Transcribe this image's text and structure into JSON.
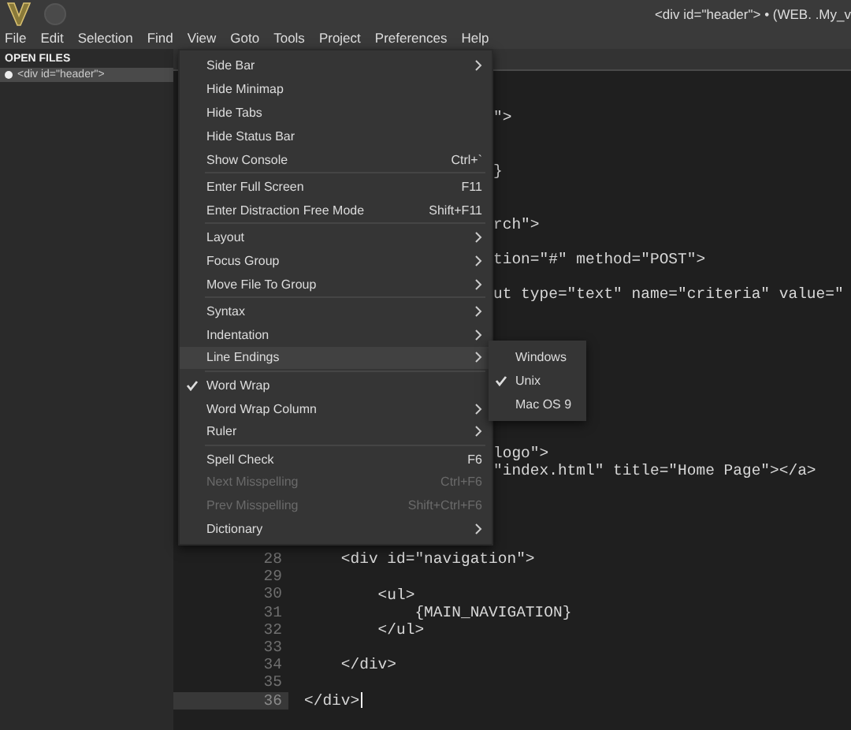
{
  "window": {
    "title": "<div id=\"header\"> • (WEB. .My_v"
  },
  "menu_bar": [
    "File",
    "Edit",
    "Selection",
    "Find",
    "View",
    "Goto",
    "Tools",
    "Project",
    "Preferences",
    "Help"
  ],
  "sidebar": {
    "heading": "OPEN FILES",
    "files": [
      {
        "label": "<div id=\"header\">",
        "selected": true
      }
    ]
  },
  "editor": {
    "lines": [
      {
        "kind": "blank",
        "current": false
      },
      {
        "kind": "blank",
        "current": false
      },
      {
        "kind": "fragment",
        "code": "\">",
        "current": false
      },
      {
        "kind": "blank",
        "current": false
      },
      {
        "kind": "blank",
        "current": false
      },
      {
        "kind": "fragment",
        "code": "}",
        "current": false
      },
      {
        "kind": "blank",
        "current": false
      },
      {
        "kind": "blank",
        "current": false
      },
      {
        "kind": "fragment",
        "code": "rch\">",
        "current": false
      },
      {
        "kind": "blank",
        "current": false
      },
      {
        "kind": "fragment",
        "code": "tion=\"#\" method=\"POST\">",
        "current": false
      },
      {
        "kind": "blank",
        "current": false
      },
      {
        "kind": "fragment",
        "code": "ut type=\"text\" name=\"criteria\" value=\"",
        "current": false
      },
      {
        "kind": "blank",
        "current": false
      },
      {
        "kind": "blank",
        "current": false
      },
      {
        "kind": "blank",
        "current": false
      },
      {
        "kind": "blank",
        "current": false
      },
      {
        "kind": "blank",
        "current": false
      },
      {
        "kind": "blank",
        "current": false
      },
      {
        "kind": "blank",
        "current": false
      },
      {
        "kind": "blank",
        "current": false
      },
      {
        "kind": "fragment",
        "code": "logo\">",
        "current": false
      },
      {
        "kind": "fragment",
        "code": "\"index.html\" title=\"Home Page\"></a>",
        "current": false
      },
      {
        "kind": "blank",
        "current": false
      },
      {
        "kind": "blank",
        "current": false
      },
      {
        "kind": "blank",
        "current": false
      },
      {
        "kind": "blank",
        "current": false
      },
      {
        "kind": "numbered",
        "number": "28",
        "code": "    <div id=\"navigation\">",
        "current": false
      },
      {
        "kind": "numbered",
        "number": "29",
        "current": false
      },
      {
        "kind": "numbered",
        "number": "30",
        "code": "        <ul>",
        "current": false
      },
      {
        "kind": "numbered",
        "number": "31",
        "code": "            {MAIN_NAVIGATION}",
        "current": false
      },
      {
        "kind": "numbered",
        "number": "32",
        "code": "        </ul>",
        "current": false
      },
      {
        "kind": "numbered",
        "number": "33",
        "current": false
      },
      {
        "kind": "numbered",
        "number": "34",
        "code": "    </div>",
        "current": false
      },
      {
        "kind": "numbered",
        "number": "35",
        "current": false
      },
      {
        "kind": "numbered",
        "number": "36",
        "code": "</div>",
        "current": true
      }
    ]
  },
  "view_menu": {
    "items": [
      {
        "kind": "item",
        "label": "Side Bar",
        "submenu": true,
        "checked": false,
        "disabled": false,
        "selected": false
      },
      {
        "kind": "item",
        "label": "Hide Minimap",
        "submenu": false,
        "checked": false,
        "disabled": false,
        "selected": false
      },
      {
        "kind": "item",
        "label": "Hide Tabs",
        "submenu": false,
        "checked": false,
        "disabled": false,
        "selected": false
      },
      {
        "kind": "item",
        "label": "Hide Status Bar",
        "submenu": false,
        "checked": false,
        "disabled": false,
        "selected": false
      },
      {
        "kind": "item",
        "label": "Show Console",
        "shortcut": "Ctrl+`",
        "submenu": false,
        "checked": false,
        "disabled": false,
        "selected": false
      },
      {
        "kind": "separator"
      },
      {
        "kind": "item",
        "label": "Enter Full Screen",
        "shortcut": "F11",
        "submenu": false,
        "checked": false,
        "disabled": false,
        "selected": false
      },
      {
        "kind": "item",
        "label": "Enter Distraction Free Mode",
        "shortcut": "Shift+F11",
        "submenu": false,
        "checked": false,
        "disabled": false,
        "selected": false
      },
      {
        "kind": "separator"
      },
      {
        "kind": "item",
        "label": "Layout",
        "submenu": true,
        "checked": false,
        "disabled": false,
        "selected": false
      },
      {
        "kind": "item",
        "label": "Focus Group",
        "submenu": true,
        "checked": false,
        "disabled": false,
        "selected": false
      },
      {
        "kind": "item",
        "label": "Move File To Group",
        "submenu": true,
        "checked": false,
        "disabled": false,
        "selected": false
      },
      {
        "kind": "separator"
      },
      {
        "kind": "item",
        "label": "Syntax",
        "submenu": true,
        "checked": false,
        "disabled": false,
        "selected": false
      },
      {
        "kind": "item",
        "label": "Indentation",
        "submenu": true,
        "checked": false,
        "disabled": false,
        "selected": false
      },
      {
        "kind": "item",
        "label": "Line Endings",
        "submenu": true,
        "checked": false,
        "disabled": false,
        "selected": true
      },
      {
        "kind": "separator"
      },
      {
        "kind": "item",
        "label": "Word Wrap",
        "submenu": false,
        "checked": true,
        "disabled": false,
        "selected": false
      },
      {
        "kind": "item",
        "label": "Word Wrap Column",
        "submenu": true,
        "checked": false,
        "disabled": false,
        "selected": false
      },
      {
        "kind": "item",
        "label": "Ruler",
        "submenu": true,
        "checked": false,
        "disabled": false,
        "selected": false
      },
      {
        "kind": "separator"
      },
      {
        "kind": "item",
        "label": "Spell Check",
        "shortcut": "F6",
        "submenu": false,
        "checked": false,
        "disabled": false,
        "selected": false
      },
      {
        "kind": "item",
        "label": "Next Misspelling",
        "shortcut": "Ctrl+F6",
        "submenu": false,
        "checked": false,
        "disabled": true,
        "selected": false
      },
      {
        "kind": "item",
        "label": "Prev Misspelling",
        "shortcut": "Shift+Ctrl+F6",
        "submenu": false,
        "checked": false,
        "disabled": true,
        "selected": false
      },
      {
        "kind": "item",
        "label": "Dictionary",
        "submenu": true,
        "checked": false,
        "disabled": false,
        "selected": false
      }
    ]
  },
  "line_endings_menu": {
    "items": [
      {
        "label": "Windows",
        "checked": false
      },
      {
        "label": "Unix",
        "checked": true
      },
      {
        "label": "Mac OS 9",
        "checked": false
      }
    ]
  }
}
